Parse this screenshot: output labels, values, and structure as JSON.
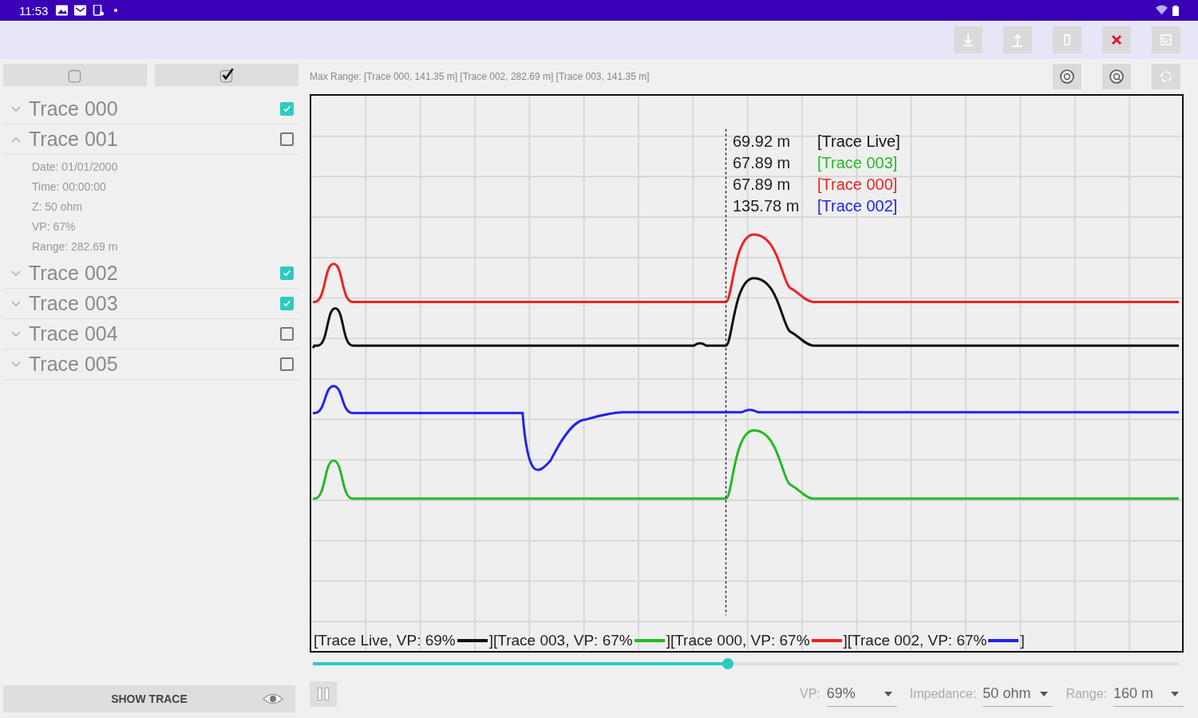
{
  "status_bar": {
    "time": "11:53"
  },
  "select_buttons": [
    {
      "kind": "none"
    },
    {
      "kind": "all"
    }
  ],
  "max_range": "Max Range: [Trace 000, 141.35 m] [Trace 002, 282.69 m] [Trace 003, 141.35 m]",
  "traces": [
    {
      "name": "Trace 000",
      "expanded": false,
      "checked": true
    },
    {
      "name": "Trace 001",
      "expanded": true,
      "checked": false,
      "details": [
        "Date: 01/01/2000",
        "Time: 00:00:00",
        "Z: 50 ohm",
        "VP: 67%",
        "Range: 282.69 m"
      ]
    },
    {
      "name": "Trace 002",
      "expanded": false,
      "checked": true
    },
    {
      "name": "Trace 003",
      "expanded": false,
      "checked": true
    },
    {
      "name": "Trace 004",
      "expanded": false,
      "checked": false
    },
    {
      "name": "Trace 005",
      "expanded": false,
      "checked": false
    }
  ],
  "chart": {
    "readouts": [
      {
        "distance": "69.92 m",
        "label": "[Trace Live]",
        "color": "#111111"
      },
      {
        "distance": "67.89 m",
        "label": "[Trace 003]",
        "color": "#22bb22"
      },
      {
        "distance": "67.89 m",
        "label": "[Trace 000]",
        "color": "#ee2222"
      },
      {
        "distance": "135.78 m",
        "label": "[Trace 002]",
        "color": "#2222ee"
      }
    ],
    "legend": [
      {
        "label": "[Trace Live, VP: 69%",
        "end": "]",
        "color": "#111111"
      },
      {
        "label": "[Trace 003, VP: 67%",
        "end": "]",
        "color": "#22bb22"
      },
      {
        "label": "[Trace 000, VP: 67%",
        "end": "]",
        "color": "#ee2222"
      },
      {
        "label": "[Trace 002, VP: 67%",
        "end": "]",
        "color": "#2222ee"
      }
    ]
  },
  "position_slider": {
    "level": 0.48
  },
  "show_trace_button": "SHOW TRACE",
  "settings": [
    {
      "label": "VP:",
      "value": "69%"
    },
    {
      "label": "Impedance:",
      "value": "50 ohm"
    },
    {
      "label": "Range:",
      "value": "160 m"
    }
  ]
}
